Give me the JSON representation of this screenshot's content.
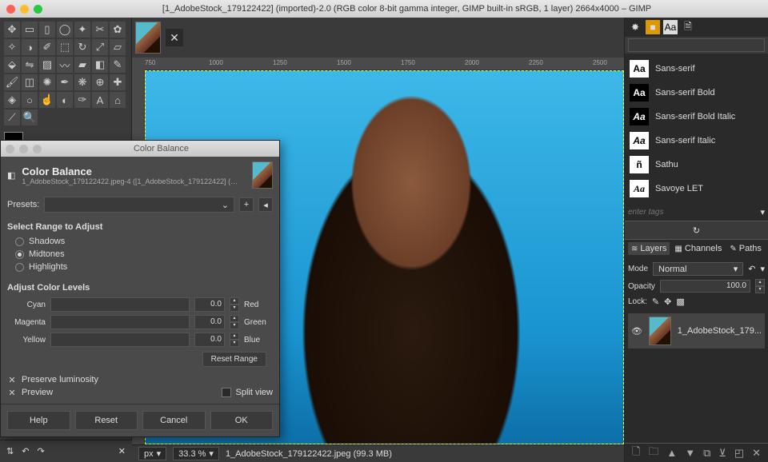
{
  "titlebar": {
    "title": "[1_AdobeStock_179122422] (imported)-2.0 (RGB color 8-bit gamma integer, GIMP built-in sRGB, 1 layer) 2664x4000 – GIMP"
  },
  "ruler": {
    "h": [
      "750",
      "1000",
      "1250",
      "1500",
      "1750",
      "2000",
      "2250",
      "2500"
    ]
  },
  "statusbar": {
    "unit": "px",
    "zoom": "33.3 %",
    "filename": "1_AdobeStock_179122422.jpeg (99.3 MB)"
  },
  "fonts": {
    "search_placeholder": "",
    "items": [
      {
        "swatch": "Aa",
        "name": "Sans-serif",
        "style": "plain"
      },
      {
        "swatch": "Aa",
        "name": "Sans-serif Bold",
        "style": "bold"
      },
      {
        "swatch": "Aa",
        "name": "Sans-serif Bold Italic",
        "style": "bolditalic"
      },
      {
        "swatch": "Aa",
        "name": "Sans-serif Italic",
        "style": "italic"
      },
      {
        "swatch": "ñ",
        "name": "Sathu",
        "style": "plain"
      },
      {
        "swatch": "Aa",
        "name": "Savoye LET",
        "style": "script"
      }
    ],
    "tags_placeholder": "enter tags"
  },
  "layers": {
    "tabs": [
      "Layers",
      "Channels",
      "Paths"
    ],
    "mode_label": "Mode",
    "mode_value": "Normal",
    "opacity_label": "Opacity",
    "opacity_value": "100.0",
    "lock_label": "Lock:",
    "item_name": "1_AdobeStock_179..."
  },
  "dialog": {
    "window_title": "Color Balance",
    "header_title": "Color Balance",
    "header_sub": "1_AdobeStock_179122422.jpeg-4 ([1_AdobeStock_179122422] (…",
    "presets_label": "Presets:",
    "range_label": "Select Range to Adjust",
    "ranges": [
      "Shadows",
      "Midtones",
      "Highlights"
    ],
    "range_selected": 1,
    "levels_label": "Adjust Color Levels",
    "sliders": [
      {
        "left": "Cyan",
        "value": "0.0",
        "right": "Red"
      },
      {
        "left": "Magenta",
        "value": "0.0",
        "right": "Green"
      },
      {
        "left": "Yellow",
        "value": "0.0",
        "right": "Blue"
      }
    ],
    "reset_range": "Reset Range",
    "preserve": "Preserve luminosity",
    "preview": "Preview",
    "split_view": "Split view",
    "buttons": [
      "Help",
      "Reset",
      "Cancel",
      "OK"
    ]
  }
}
